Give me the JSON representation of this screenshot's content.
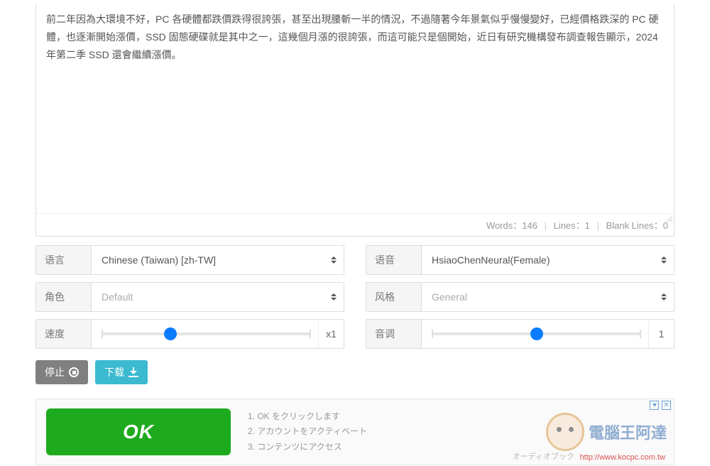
{
  "textarea": {
    "value": "前二年因為大環境不好，PC 各硬體都跌價跌得很誇張，甚至出現腰斬一半的情況，不過隨著今年景氣似乎慢慢變好，已經價格跌深的 PC 硬體，也逐漸開始漲價，SSD 固態硬碟就是其中之一，這幾個月漲的很誇張，而這可能只是個開始，近日有研究機構發布調查報告顯示，2024 年第二季 SSD 還會繼續漲價。"
  },
  "stats": {
    "words_label": "Words：",
    "words_value": "146",
    "lines_label": "Lines：",
    "lines_value": "1",
    "blank_label": "Blank Lines：",
    "blank_value": "0"
  },
  "labels": {
    "language": "语言",
    "voice": "语音",
    "role": "角色",
    "style": "风格",
    "speed": "速度",
    "pitch": "音调"
  },
  "values": {
    "language": "Chinese (Taiwan) [zh-TW]",
    "voice": "HsiaoChenNeural(Female)",
    "role": "Default",
    "style": "General",
    "speed": "x1",
    "pitch": "1"
  },
  "slider": {
    "speed_percent": 33,
    "pitch_percent": 50
  },
  "buttons": {
    "stop": "停止",
    "download": "下载"
  },
  "ad": {
    "ok": "OK",
    "step1": "1. OK をクリックします",
    "step2": "2. アカウントをアクティベート",
    "step3": "3. コンテンツにアクセス",
    "brand": "電腦王阿達",
    "url": "http://www.kocpc.com.tw",
    "bottom": "オーディオブック"
  }
}
